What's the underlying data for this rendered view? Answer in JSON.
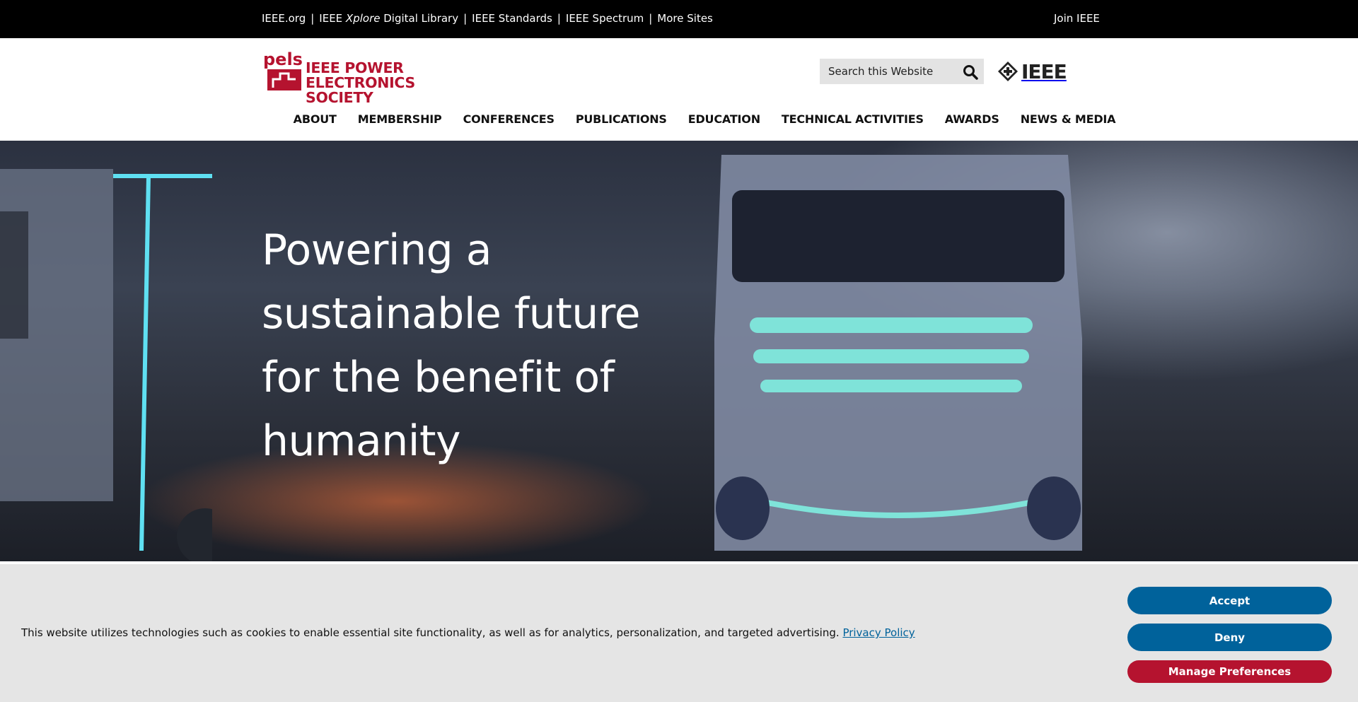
{
  "utility_bar": {
    "links": [
      {
        "label": "IEEE.org"
      },
      {
        "label_pre": "IEEE ",
        "label_em": "Xplore",
        "label_post": " Digital Library"
      },
      {
        "label": "IEEE Standards"
      },
      {
        "label": "IEEE Spectrum"
      },
      {
        "label": "More Sites"
      }
    ],
    "separator": "|",
    "join_label": "Join IEEE"
  },
  "header": {
    "logo_mark_text": "pels",
    "logo_line1": "IEEE POWER",
    "logo_line2": "ELECTRONICS SOCIETY",
    "search_placeholder": "Search this Website",
    "ieee_label": "IEEE",
    "brand_color": "#b5132f"
  },
  "nav": {
    "items": [
      "ABOUT",
      "MEMBERSHIP",
      "CONFERENCES",
      "PUBLICATIONS",
      "EDUCATION",
      "TECHNICAL ACTIVITIES",
      "AWARDS",
      "NEWS & MEDIA"
    ]
  },
  "hero": {
    "title_lines": [
      "Powering a",
      "sustainable future",
      "for the benefit of",
      "humanity"
    ]
  },
  "cookie": {
    "text": "This website utilizes technologies such as cookies to enable essential site functionality, as well as for analytics, personalization, and targeted advertising.",
    "privacy_label": "Privacy Policy",
    "accept_label": "Accept",
    "deny_label": "Deny",
    "manage_label": "Manage Preferences",
    "primary_color": "#00629b",
    "secondary_color": "#b5132f"
  }
}
